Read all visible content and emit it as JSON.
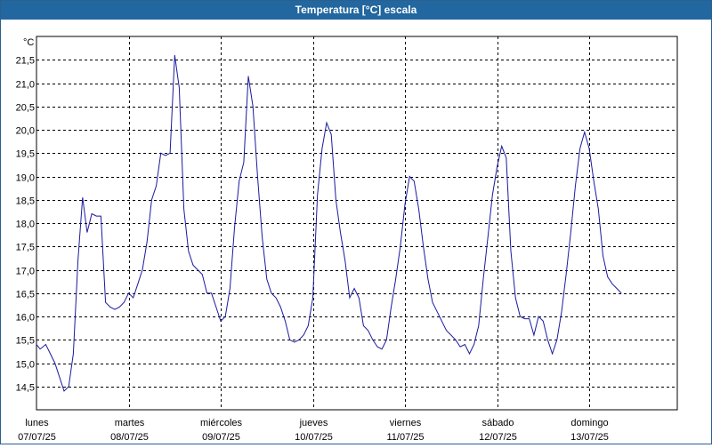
{
  "window": {
    "title": "Temperatura [°C] escala"
  },
  "chart_data": {
    "type": "line",
    "title": "Temperatura [°C] escala",
    "unit": "°C",
    "ylim": [
      14.0,
      22.0
    ],
    "y_ticks": [
      "14,5",
      "15,0",
      "15,5",
      "16,0",
      "16,5",
      "17,0",
      "17,5",
      "18,0",
      "18,5",
      "19,0",
      "19,5",
      "20,0",
      "20,5",
      "21,0",
      "21,5"
    ],
    "x_categories": [
      {
        "day": "lunes",
        "date": "07/07/25"
      },
      {
        "day": "martes",
        "date": "08/07/25"
      },
      {
        "day": "miércoles",
        "date": "09/07/25"
      },
      {
        "day": "jueves",
        "date": "10/07/25"
      },
      {
        "day": "viernes",
        "date": "11/07/25"
      },
      {
        "day": "sábado",
        "date": "12/07/25"
      },
      {
        "day": "domingo",
        "date": "13/07/25"
      }
    ],
    "grid": true,
    "line_color": "#1a1aa0",
    "series": [
      {
        "x_days": [
          0.0,
          0.04,
          0.1,
          0.2,
          0.25,
          0.3,
          0.35,
          0.4,
          0.45,
          0.5,
          0.55,
          0.6,
          0.65,
          0.7,
          0.75,
          0.8,
          0.85,
          0.9,
          0.95,
          1.0,
          1.05,
          1.1,
          1.15,
          1.2,
          1.25,
          1.3,
          1.35,
          1.4,
          1.45,
          1.5,
          1.55,
          1.6,
          1.65,
          1.7,
          1.75,
          1.8,
          1.85,
          1.9,
          1.95,
          2.0,
          2.05,
          2.1,
          2.15,
          2.2,
          2.25,
          2.3,
          2.35,
          2.4,
          2.45,
          2.5,
          2.55,
          2.6,
          2.65,
          2.7,
          2.75,
          2.8,
          2.85,
          2.9,
          2.95,
          3.0,
          3.05,
          3.1,
          3.15,
          3.2,
          3.25,
          3.3,
          3.35,
          3.4,
          3.45,
          3.5,
          3.55,
          3.6,
          3.65,
          3.7,
          3.75,
          3.8,
          3.85,
          3.9,
          3.95,
          4.0,
          4.05,
          4.1,
          4.15,
          4.2,
          4.25,
          4.3,
          4.35,
          4.4,
          4.45,
          4.5,
          4.55,
          4.6,
          4.65,
          4.7,
          4.75,
          4.8,
          4.85,
          4.9,
          4.95,
          5.0,
          5.05,
          5.1,
          5.15,
          5.2,
          5.25,
          5.3,
          5.35,
          5.4,
          5.45,
          5.5,
          5.55,
          5.6,
          5.65,
          5.7,
          5.75,
          5.8,
          5.85,
          5.9,
          5.95,
          6.0,
          6.05,
          6.1,
          6.15,
          6.2,
          6.25,
          6.3,
          6.35,
          6.4,
          6.45,
          6.5,
          6.55,
          6.6,
          6.65,
          6.7,
          6.75,
          6.8,
          6.85,
          6.9,
          6.95
        ],
        "values": [
          15.4,
          15.3,
          15.4,
          15.0,
          14.7,
          14.4,
          14.5,
          15.2,
          17.2,
          18.55,
          17.8,
          18.2,
          18.15,
          18.15,
          16.3,
          16.2,
          16.15,
          16.2,
          16.3,
          16.5,
          16.4,
          16.7,
          17.0,
          17.6,
          18.5,
          18.8,
          19.5,
          19.45,
          19.5,
          21.6,
          20.9,
          18.3,
          17.4,
          17.1,
          17.0,
          16.9,
          16.5,
          16.5,
          16.2,
          15.9,
          16.0,
          16.6,
          17.9,
          18.9,
          19.3,
          21.15,
          20.5,
          19.0,
          17.7,
          16.8,
          16.5,
          16.4,
          16.2,
          15.9,
          15.5,
          15.45,
          15.5,
          15.6,
          15.8,
          16.4,
          18.6,
          19.6,
          20.15,
          19.9,
          18.5,
          17.8,
          17.2,
          16.4,
          16.6,
          16.4,
          15.8,
          15.7,
          15.5,
          15.35,
          15.3,
          15.5,
          16.2,
          16.8,
          17.5,
          18.4,
          19.0,
          18.9,
          18.3,
          17.5,
          16.8,
          16.3,
          16.1,
          15.9,
          15.7,
          15.6,
          15.5,
          15.35,
          15.4,
          15.2,
          15.4,
          15.8,
          16.8,
          17.7,
          18.6,
          19.2,
          19.65,
          19.4,
          17.4,
          16.4,
          16.0,
          15.95,
          15.95,
          15.6,
          16.0,
          15.9,
          15.5,
          15.2,
          15.5,
          16.1,
          16.9,
          17.8,
          18.8,
          19.6,
          19.95,
          19.6,
          18.9,
          18.3,
          17.3,
          16.85,
          16.7,
          16.6,
          16.5
        ]
      }
    ]
  }
}
